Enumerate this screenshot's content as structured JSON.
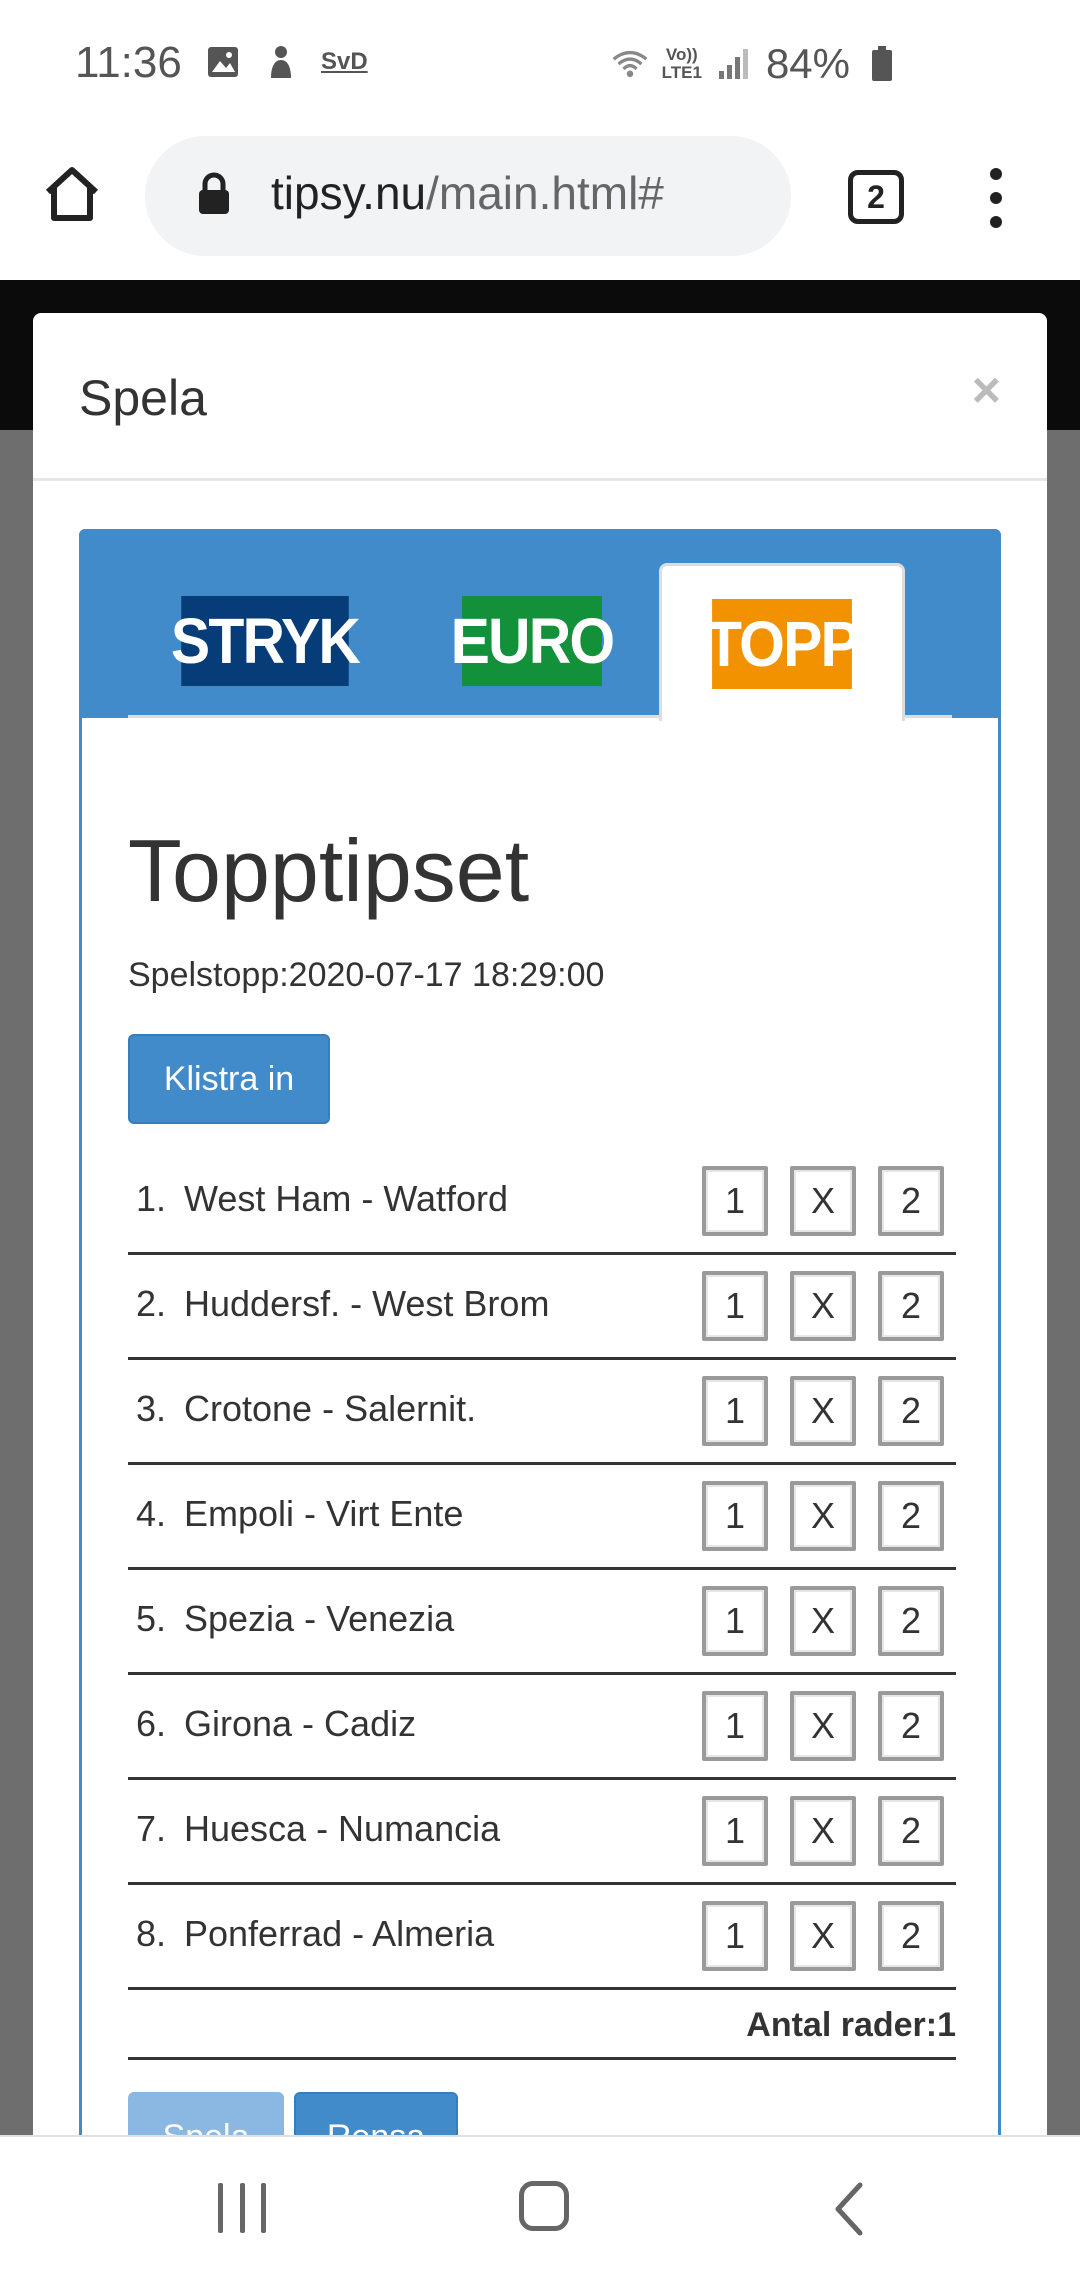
{
  "status_bar": {
    "time": "11:36",
    "icons": [
      "image-icon",
      "touch-icon",
      "svd-app-icon",
      "wifi-icon",
      "volte-icon",
      "signal-icon",
      "battery-icon"
    ],
    "svd_label": "SvD",
    "volte_label_top": "Vo))",
    "volte_label_bottom": "LTE1",
    "battery_percent": "84%",
    "battery_level": 0.84
  },
  "browser": {
    "url_host": "tipsy.nu",
    "url_path": "/main.html#",
    "tab_count": "2"
  },
  "modal": {
    "title": "Spela",
    "close_label": "×",
    "tabs": [
      {
        "label": "STRYK",
        "color": "#063d79",
        "active": false
      },
      {
        "label": "EURO",
        "color": "#12913a",
        "active": false
      },
      {
        "label": "TOPP",
        "color": "#f39200",
        "active": true
      }
    ],
    "game_title": "Topptipset",
    "deadline": "Spelstopp:2020-07-17 18:29:00",
    "paste_label": "Klistra in",
    "options": [
      "1",
      "X",
      "2"
    ],
    "matches": [
      {
        "num": "1.",
        "name": "West Ham - Watford"
      },
      {
        "num": "2.",
        "name": "Huddersf. - West Brom"
      },
      {
        "num": "3.",
        "name": "Crotone - Salernit."
      },
      {
        "num": "4.",
        "name": "Empoli - Virt Ente"
      },
      {
        "num": "5.",
        "name": "Spezia - Venezia"
      },
      {
        "num": "6.",
        "name": "Girona - Cadiz"
      },
      {
        "num": "7.",
        "name": "Huesca - Numancia"
      },
      {
        "num": "8.",
        "name": "Ponferrad - Almeria"
      }
    ],
    "rows_count": "Antal rader:1",
    "play_label": "Spela",
    "clear_label": "Rensa"
  },
  "colors": {
    "primary": "#428bca",
    "primary_disabled": "#8ab8e2",
    "topp": "#f39200",
    "stryk": "#063d79",
    "euro": "#12913a"
  }
}
